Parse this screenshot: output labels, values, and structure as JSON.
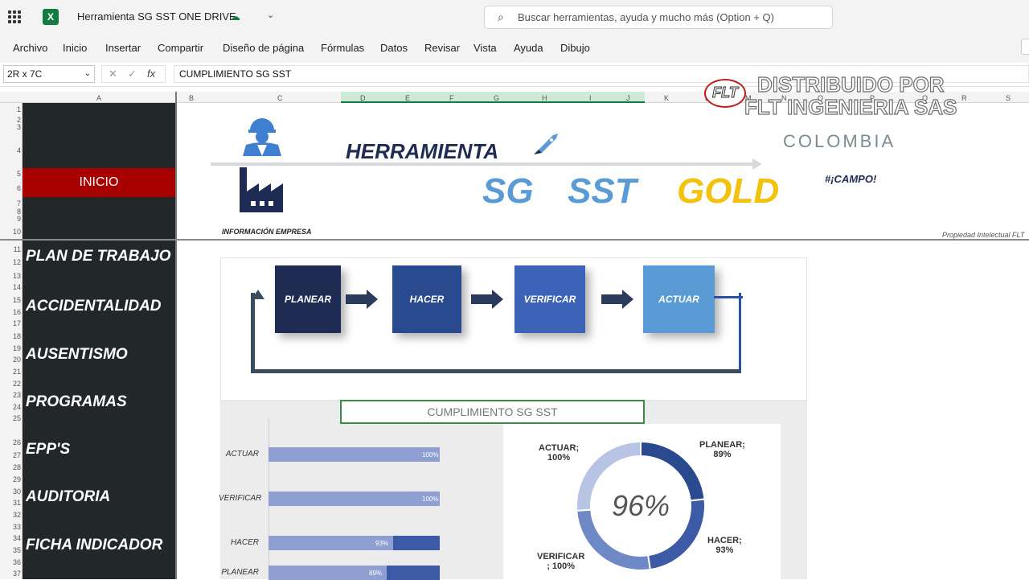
{
  "titlebar": {
    "app_icon": "X",
    "doc_title": "Herramienta SG SST ONE DRIVE",
    "search_placeholder": "Buscar herramientas, ayuda y mucho más (Option + Q)"
  },
  "menu": [
    "Archivo",
    "Inicio",
    "Insertar",
    "Compartir",
    "Diseño de página",
    "Fórmulas",
    "Datos",
    "Revisar",
    "Vista",
    "Ayuda",
    "Dibujo"
  ],
  "formula": {
    "name_box": "2R x 7C",
    "fx": "fx",
    "content": "CUMPLIMIENTO SG SST"
  },
  "columns": [
    "A",
    "B",
    "C",
    "D",
    "E",
    "F",
    "G",
    "H",
    "I",
    "J",
    "K",
    "L",
    "M",
    "N",
    "O",
    "P",
    "Q",
    "R",
    "S"
  ],
  "rows": [
    "1",
    "2",
    "3",
    "4",
    "5",
    "6",
    "7",
    "8",
    "9",
    "10",
    "11",
    "12",
    "13",
    "14",
    "15",
    "16",
    "17",
    "18",
    "19",
    "20",
    "21",
    "22",
    "23",
    "24",
    "25",
    "26",
    "27",
    "28",
    "29",
    "30",
    "31",
    "32",
    "33",
    "34",
    "35",
    "36",
    "37"
  ],
  "sidebar": {
    "inicio": "INICIO",
    "items": [
      "PLAN DE TRABAJO",
      "ACCIDENTALIDAD",
      "AUSENTISMO",
      "PROGRAMAS",
      "EPP'S",
      "AUDITORIA",
      "FICHA INDICADOR"
    ]
  },
  "banner": {
    "herramienta": "HERRAMIENTA",
    "sg": "SG",
    "sst": "SST",
    "gold": "GOLD",
    "campo": "#¡CAMPO!",
    "info_empresa": "INFORMACIÓN EMPRESA",
    "propiedad": "Propiedad Intelectual FLT",
    "dist_line1": "DISTRIBUIDO POR",
    "dist_line2": "FLT INGENIERIA SAS",
    "colombia": "COLOMBIA",
    "logo": "FLT"
  },
  "pdca": [
    "PLANEAR",
    "HACER",
    "VERIFICAR",
    "ACTUAR"
  ],
  "chart_title": "CUMPLIMIENTO SG SST",
  "chart_data": [
    {
      "type": "bar",
      "categories": [
        "ACTUAR",
        "VERIFICAR",
        "HACER",
        "PLANEAR"
      ],
      "values": [
        100,
        100,
        93,
        89
      ],
      "value_labels": [
        "100%",
        "100%",
        "93%",
        "89%"
      ],
      "xlim": [
        0,
        100
      ]
    },
    {
      "type": "pie",
      "labels": [
        "PLANEAR",
        "HACER",
        "VERIFICAR",
        "ACTUAR"
      ],
      "values": [
        89,
        93,
        100,
        100
      ],
      "slice_labels": [
        "PLANEAR;",
        "HACER;",
        "VERIFICAR",
        "ACTUAR;"
      ],
      "slice_values": [
        "89%",
        "93%",
        "; 100%",
        "100%"
      ],
      "center_label": "96%"
    }
  ],
  "colors": {
    "excel_green": "#107c41",
    "sidebar": "#222829",
    "inicio": "#a80000",
    "planear": "#1e2b52",
    "hacer": "#2a4a8f",
    "verificar": "#3d63b8",
    "actuar": "#5b9bd5",
    "gold": "#f4c20d",
    "bar_fg": "#8f9fd2",
    "bar_bg": "#3c5aa6"
  },
  "icons": {
    "waffle": "waffle-icon",
    "cloud": "cloud-sync-icon",
    "search": "search-icon",
    "worker": "worker-icon",
    "factory": "factory-icon",
    "rocket": "rocket-icon"
  }
}
